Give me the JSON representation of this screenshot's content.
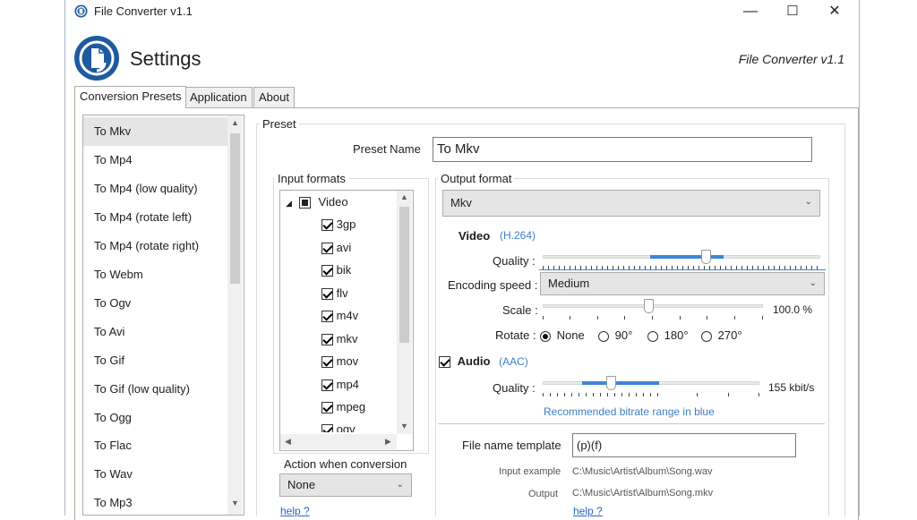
{
  "window": {
    "title": "File Converter v1.1",
    "minimize": "—",
    "maximize": "☐",
    "close": "✕"
  },
  "header": {
    "title": "Settings",
    "version": "File Converter v1.1"
  },
  "tabs": [
    {
      "label": "Conversion Presets"
    },
    {
      "label": "Application"
    },
    {
      "label": "About"
    }
  ],
  "presets": [
    "To Mkv",
    "To Mp4",
    "To Mp4 (low quality)",
    "To Mp4 (rotate left)",
    "To Mp4 (rotate right)",
    "To Webm",
    "To Ogv",
    "To Avi",
    "To Gif",
    "To Gif (low quality)",
    "To Ogg",
    "To Flac",
    "To Wav",
    "To Mp3"
  ],
  "preset": {
    "group_label": "Preset",
    "name_label": "Preset Name",
    "name_value": "To Mkv",
    "input_formats_label": "Input formats",
    "tree_root": "Video",
    "formats": [
      "3gp",
      "avi",
      "bik",
      "flv",
      "m4v",
      "mkv",
      "mov",
      "mp4",
      "mpeg",
      "ogv"
    ],
    "action_label": "Action when conversion",
    "action_value": "None",
    "help_left": "help ?"
  },
  "output": {
    "group_label": "Output format",
    "format_value": "Mkv",
    "video_label": "Video",
    "video_codec": "(H.264)",
    "quality_label": "Quality :",
    "video_quality": 0.62,
    "encoding_speed_label": "Encoding speed :",
    "encoding_speed_value": "Medium",
    "scale_label": "Scale :",
    "scale_value": "100.0 %",
    "rotate_label": "Rotate :",
    "rotate_options": [
      "None",
      "90°",
      "180°",
      "270°"
    ],
    "audio_label": "Audio",
    "audio_codec": "(AAC)",
    "audio_quality_label": "Quality :",
    "audio_bitrate": "155 kbit/s",
    "recommended_text": "Recommended bitrate range in blue",
    "template_label": "File name template",
    "template_value": "(p)(f)",
    "input_example_label": "Input example",
    "input_example_value": "C:\\Music\\Artist\\Album\\Song.wav",
    "output_label": "Output",
    "output_value": "C:\\Music\\Artist\\Album\\Song.mkv",
    "help_right": "help ?"
  },
  "colors": {
    "accent": "#3d86d8",
    "logo": "#1e5aa0",
    "link": "#2a66c8"
  }
}
